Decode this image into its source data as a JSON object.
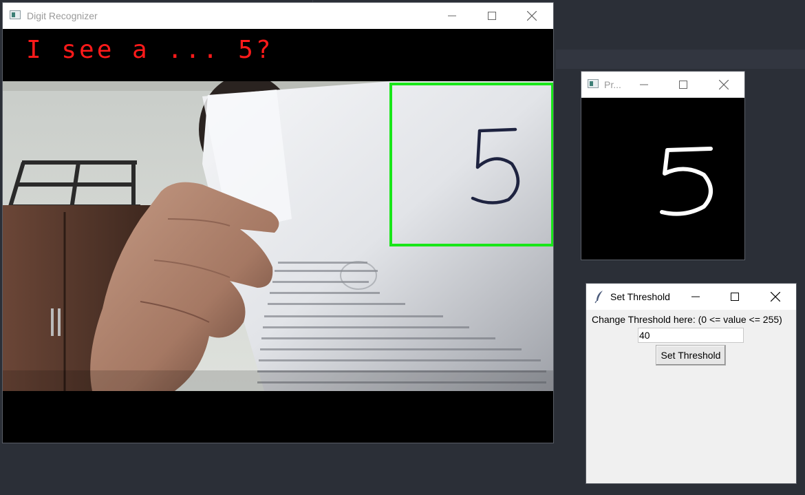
{
  "desktop": {
    "background": "#2b2f37"
  },
  "main_window": {
    "title": "Digit Recognizer",
    "prediction_text": "I see a ... 5?",
    "prediction_color": "#ff1a1a",
    "roi_box_color": "#19e619"
  },
  "preview_window": {
    "title": "Pr...",
    "digit": "5"
  },
  "threshold_window": {
    "title": "Set Threshold",
    "label": "Change Threshold here: (0 <= value <= 255)",
    "input_value": "40",
    "button_label": "Set Threshold"
  },
  "window_controls": {
    "minimize_icon": "minimize-icon",
    "maximize_icon": "maximize-icon",
    "close_icon": "close-icon"
  }
}
